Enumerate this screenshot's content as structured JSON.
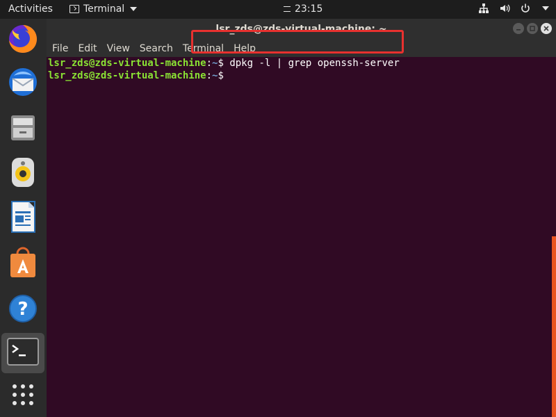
{
  "topbar": {
    "activities": "Activities",
    "app_name": "Terminal",
    "time": "23:15"
  },
  "dock": {
    "items": [
      {
        "name": "Firefox"
      },
      {
        "name": "Thunderbird"
      },
      {
        "name": "Files"
      },
      {
        "name": "Rhythmbox"
      },
      {
        "name": "LibreOffice Writer"
      },
      {
        "name": "Ubuntu Software"
      },
      {
        "name": "Help"
      },
      {
        "name": "Terminal"
      },
      {
        "name": "Show Applications"
      }
    ]
  },
  "window": {
    "title": "lsr_zds@zds-virtual-machine: ~",
    "menu": [
      "File",
      "Edit",
      "View",
      "Search",
      "Terminal",
      "Help"
    ]
  },
  "terminal": {
    "lines": [
      {
        "user": "lsr_zds@zds-virtual-machine",
        "path": "~",
        "prompt": "$ ",
        "command": "dpkg -l | grep openssh-server"
      },
      {
        "user": "lsr_zds@zds-virtual-machine",
        "path": "~",
        "prompt": "$ ",
        "command": ""
      }
    ]
  },
  "colors": {
    "terminal_bg": "#300a24",
    "user": "#8ae234",
    "path": "#729fcf",
    "highlight": "#e8312f",
    "accent": "#e95420"
  }
}
